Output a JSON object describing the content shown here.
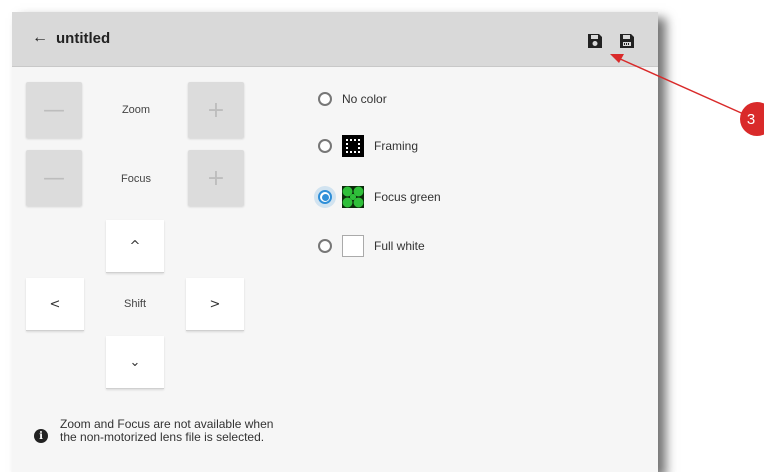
{
  "header": {
    "back_icon": "arrow-left-icon",
    "title": "untitled"
  },
  "toolbar": {
    "save_icon": "floppy-disk-icon",
    "save_as_icon": "floppy-disk-plus-icon"
  },
  "controls": {
    "zoom_label": "Zoom",
    "focus_label": "Focus",
    "shift_label": "Shift",
    "minus_glyph": "—",
    "plus_glyph": "+",
    "up_glyph": "^",
    "down_glyph": "⌄",
    "left_glyph": "<",
    "right_glyph": ">"
  },
  "patterns": [
    {
      "label": "No color",
      "selected": false
    },
    {
      "label": "Framing",
      "selected": false
    },
    {
      "label": "Focus green",
      "selected": true
    },
    {
      "label": "Full white",
      "selected": false
    }
  ],
  "info": {
    "text": "Zoom and Focus are not available when the non-motorized lens file is selected."
  },
  "callout": {
    "number": "3",
    "color": "#d92a2a"
  },
  "colors": {
    "accent": "#2f8fd8",
    "header_bg": "#d9d9d9"
  }
}
